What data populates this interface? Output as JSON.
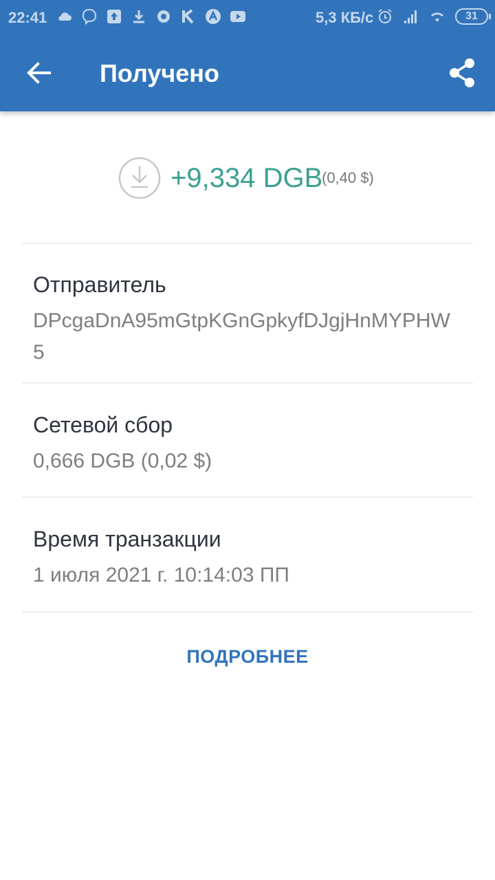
{
  "status_bar": {
    "time": "22:41",
    "speed": "5,3 КБ/с",
    "battery": "31",
    "left_icons": [
      "cloud-icon",
      "viber-icon",
      "upload-icon",
      "download-icon",
      "chat-icon",
      "k-icon",
      "a-icon",
      "youtube-icon"
    ],
    "right_icons": [
      "alarm-icon",
      "signal-icon",
      "wifi-icon",
      "battery-icon"
    ]
  },
  "toolbar": {
    "title": "Получено",
    "back_icon": "arrow-back-icon",
    "share_icon": "share-icon",
    "color": "#3274bc"
  },
  "transaction": {
    "amount": "+9,334 DGB",
    "amount_fiat": "(0,40 $)",
    "amount_color": "#3aa090",
    "sender_label": "Отправитель",
    "sender_value": "DPcgaDnA95mGtpKGnGpkyfDJgjHnMYPHW5",
    "fee_label": "Сетевой сбор",
    "fee_value": "0,666 DGB (0,02 $)",
    "time_label": "Время транзакции",
    "time_value": "1 июля 2021 г. 10:14:03 ПП"
  },
  "actions": {
    "more_label": "ПОДРОБНЕЕ"
  }
}
